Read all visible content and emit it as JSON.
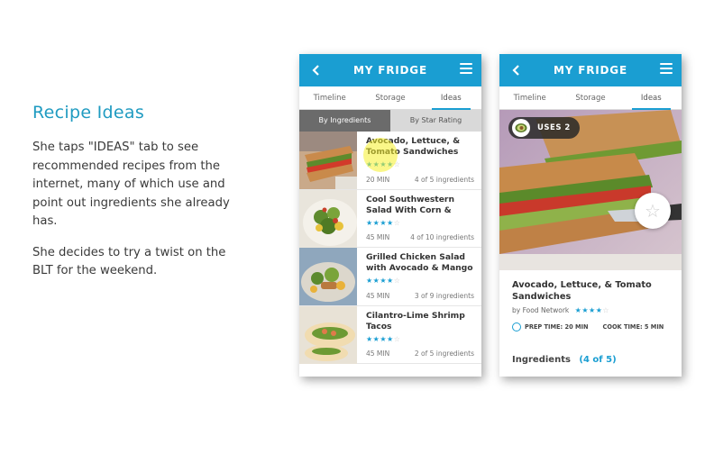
{
  "narrative": {
    "heading": "Recipe Ideas",
    "paragraph1": "She taps \"IDEAS\" tab to see recommended recipes from the internet, many of which use and point out ingredients she already has.",
    "paragraph2": "She decides to try a twist on the BLT for the weekend."
  },
  "app": {
    "title": "MY FRIDGE",
    "tabs": [
      "Timeline",
      "Storage",
      "Ideas"
    ],
    "active_tab": "Ideas",
    "accent_color": "#1a9ed2"
  },
  "list_screen": {
    "segment": {
      "by_ingredients": "By Ingredients",
      "by_star_rating": "By Star Rating"
    },
    "recipes": [
      {
        "name": "Avocado, Lettuce, & Tomato Sandwiches",
        "stars": "★★★★",
        "empty_stars": "☆",
        "time": "20 MIN",
        "ingredients": "4 of 5 ingredients"
      },
      {
        "name": "Cool Southwestern Salad With Corn &",
        "stars": "★★★★",
        "empty_stars": "☆",
        "time": "45 MIN",
        "ingredients": "4 of 10 ingredients"
      },
      {
        "name": "Grilled Chicken Salad with Avocado & Mango",
        "stars": "★★★★",
        "empty_stars": "☆",
        "time": "45 MIN",
        "ingredients": "3 of 9 ingredients"
      },
      {
        "name": "Cilantro-Lime Shrimp Tacos",
        "stars": "★★★★",
        "empty_stars": "☆",
        "time": "45 MIN",
        "ingredients": "2 of 5 ingredients"
      }
    ]
  },
  "detail_screen": {
    "uses_badge": "USES 2",
    "title": "Avocado, Lettuce, & Tomato Sandwiches",
    "source": "by Food Network",
    "stars": "★★★★",
    "empty_stars": "☆",
    "prep_time": "PREP TIME: 20 MIN",
    "cook_time": "COOK TIME: 5 MIN",
    "ingredients_label": "Ingredients",
    "ingredients_count": "(4 of 5)",
    "favorite_icon": "☆"
  }
}
